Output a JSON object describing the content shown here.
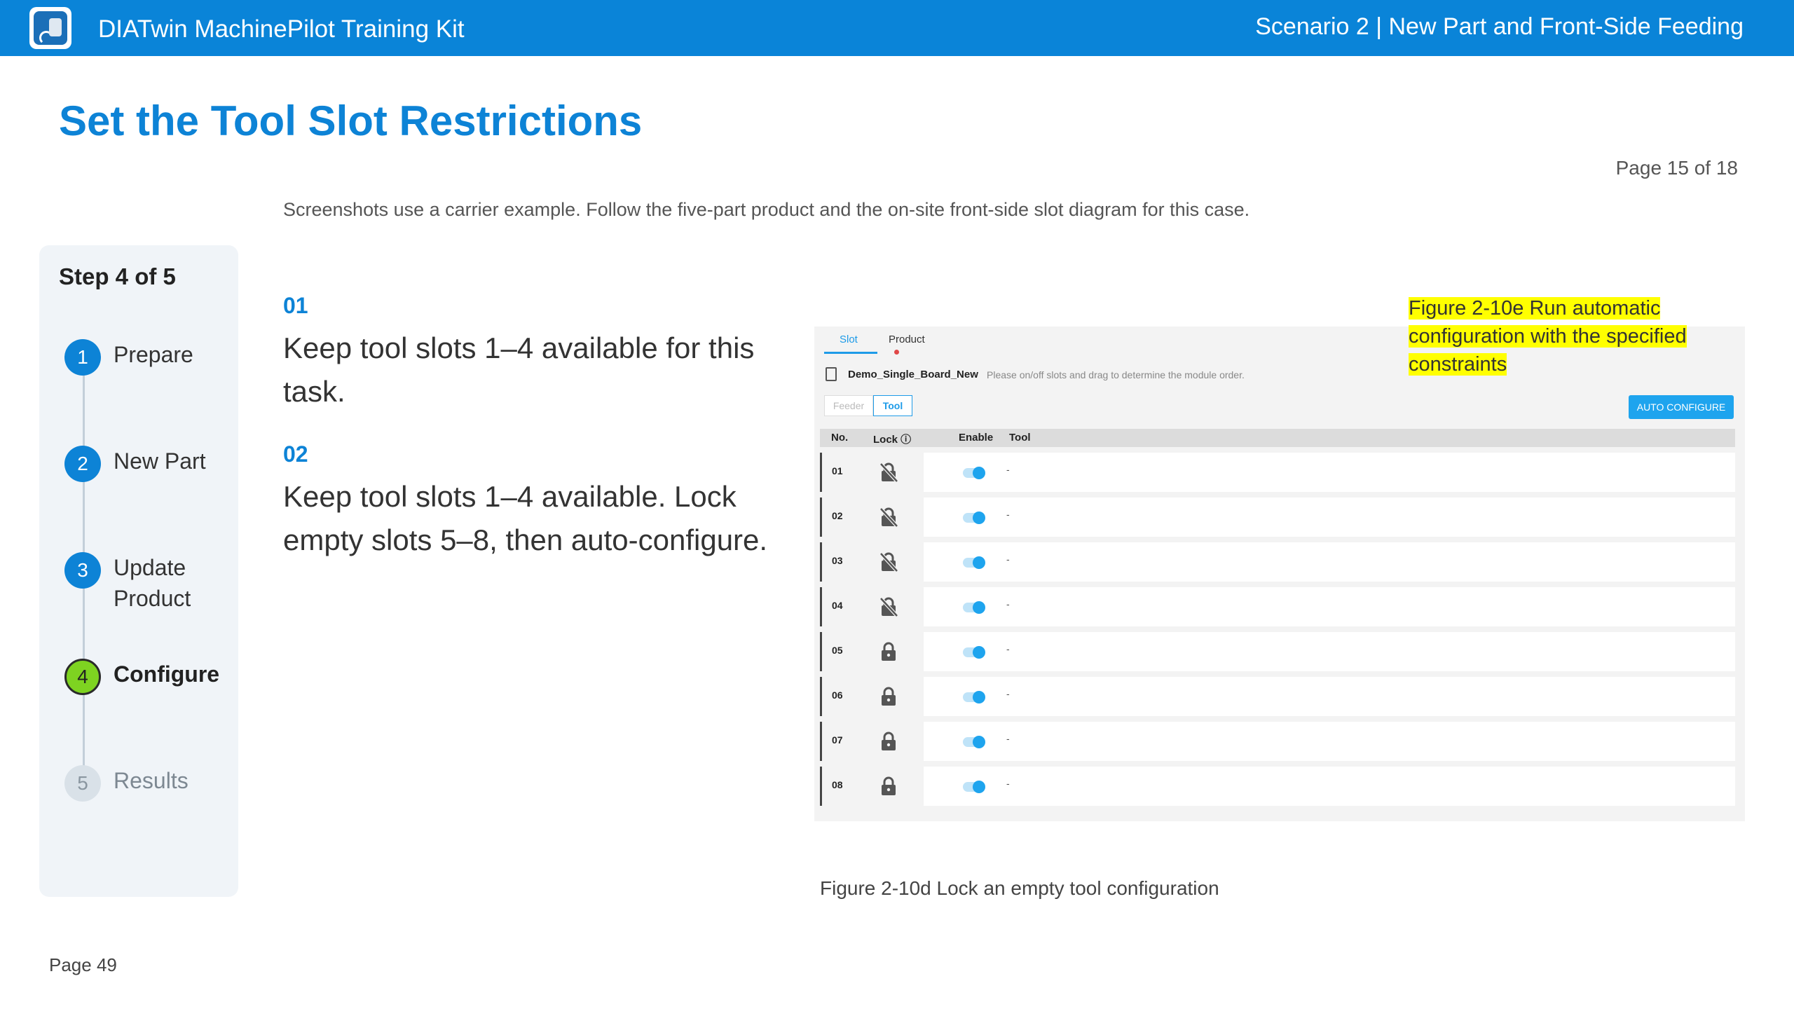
{
  "header": {
    "app_title": "DIATwin MachinePilot Training Kit",
    "scenario": "Scenario 2 | New Part and Front-Side Feeding",
    "logo_icon": "robot-arm-app-icon"
  },
  "page_title": "Set the Tool Slot Restrictions",
  "page_count": "Page 15 of 18",
  "note": "Screenshots use a carrier example. Follow the five-part product and the on-site front-side slot diagram for this case.",
  "stepper": {
    "title": "Step 4 of 5",
    "steps": [
      {
        "num": "1",
        "label": "Prepare",
        "state": "done"
      },
      {
        "num": "2",
        "label": "New Part",
        "state": "done"
      },
      {
        "num": "3",
        "label": "Update Product",
        "state": "done"
      },
      {
        "num": "4",
        "label": "Configure",
        "state": "active"
      },
      {
        "num": "5",
        "label": "Results",
        "state": "pending"
      }
    ]
  },
  "instructions": [
    {
      "num": "01",
      "text": "Keep tool slots 1–4 available for this task."
    },
    {
      "num": "02",
      "text": "Keep tool slots 1–4 available. Lock empty slots 5–8, then auto-configure."
    }
  ],
  "screenshot": {
    "tabs": {
      "slot": "Slot",
      "product": "Product"
    },
    "board_name": "Demo_Single_Board_New",
    "board_hint": "Please on/off slots and drag to determine the module order.",
    "seg_feeder": "Feeder",
    "seg_tool": "Tool",
    "auto_button": "AUTO CONFIGURE",
    "columns": {
      "no": "No.",
      "lock": "Lock ⓘ",
      "enable": "Enable",
      "tool": "Tool"
    },
    "rows": [
      {
        "no": "01",
        "locked": false,
        "enabled": true,
        "tool": "-"
      },
      {
        "no": "02",
        "locked": false,
        "enabled": true,
        "tool": "-"
      },
      {
        "no": "03",
        "locked": false,
        "enabled": true,
        "tool": "-"
      },
      {
        "no": "04",
        "locked": false,
        "enabled": true,
        "tool": "-"
      },
      {
        "no": "05",
        "locked": true,
        "enabled": true,
        "tool": "-"
      },
      {
        "no": "06",
        "locked": true,
        "enabled": true,
        "tool": "-"
      },
      {
        "no": "07",
        "locked": true,
        "enabled": true,
        "tool": "-"
      },
      {
        "no": "08",
        "locked": true,
        "enabled": true,
        "tool": "-"
      }
    ]
  },
  "figure_e": "Figure 2-10e  Run automatic configuration with the specified constraints",
  "figure_d": "Figure 2-10d  Lock an empty tool configuration",
  "footer_page": "Page 49",
  "colors": {
    "header": "#0a84d8",
    "accent": "#0d83d6",
    "active_step": "#7ed321",
    "highlight": "#ffff00"
  }
}
